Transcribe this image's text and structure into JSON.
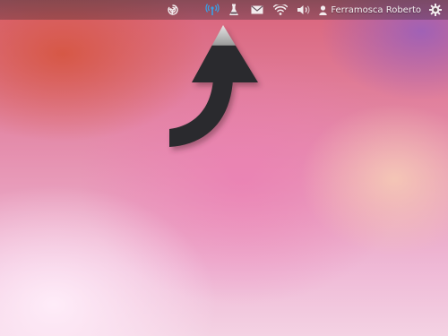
{
  "panel": {
    "indicators": [
      {
        "icon": "spiral-app-icon"
      },
      {
        "icon": "broadcast-antenna-icon",
        "active": true
      },
      {
        "icon": "flask-icon"
      },
      {
        "icon": "envelope-icon"
      },
      {
        "icon": "wifi-icon"
      },
      {
        "icon": "speaker-volume-icon"
      }
    ],
    "user_name": "Ferramosca Roberto",
    "user_icon": "person-icon",
    "session_icon": "gear-power-icon",
    "colors": {
      "active_indicator": "#3aa0e6",
      "icon": "#f2ecee"
    }
  },
  "hint_arrow": {
    "icon": "curved-up-arrow-icon",
    "fill": "#2b2b2d"
  }
}
